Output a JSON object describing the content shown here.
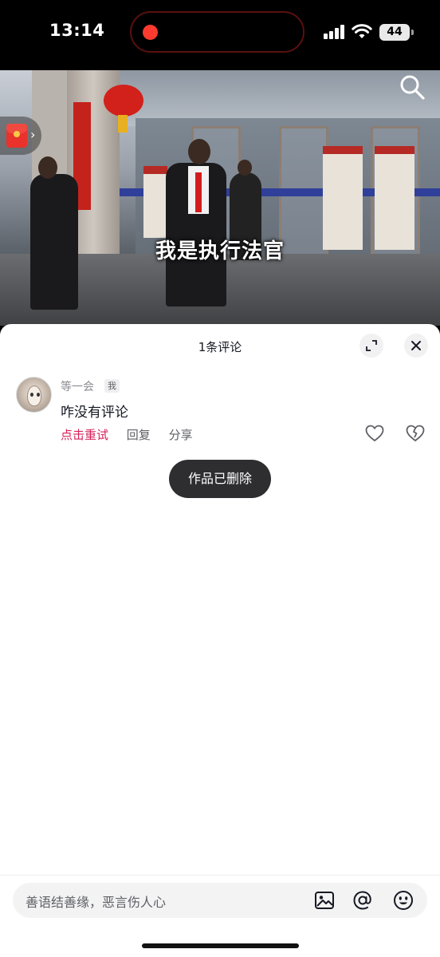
{
  "status_bar": {
    "time": "13:14",
    "battery": "44"
  },
  "video": {
    "caption": "我是执行法官"
  },
  "sheet": {
    "title": "1条评论"
  },
  "comments": [
    {
      "username": "等一会",
      "tag": "我",
      "text": "咋没有评论",
      "actions": [
        "点击重试",
        "回复",
        "分享"
      ]
    }
  ],
  "toast": "作品已删除",
  "input": {
    "placeholder": "善语结善缘，恶言伤人心"
  },
  "colors": {
    "accent": "#d6235a",
    "toast_bg": "#2e2e31",
    "recording": "#ff3b30"
  }
}
